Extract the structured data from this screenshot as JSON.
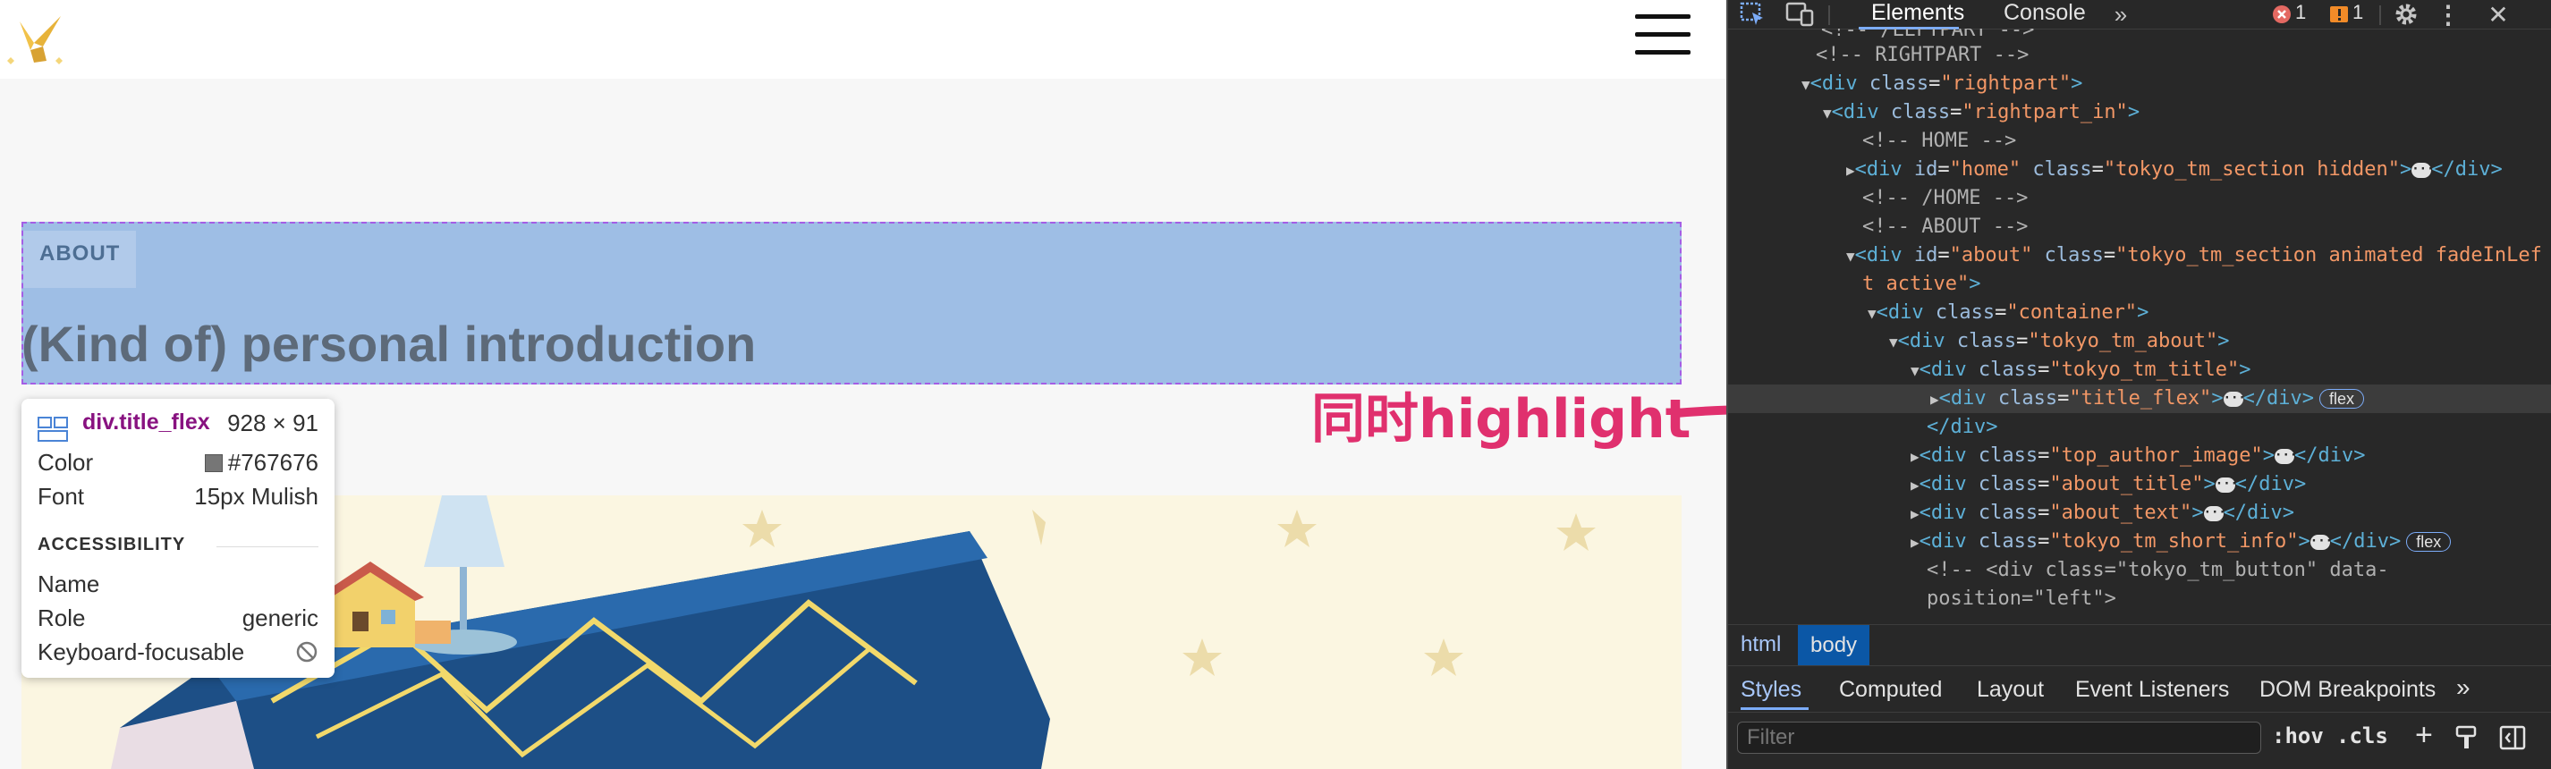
{
  "page": {
    "about_label": "ABOUT",
    "title": "(Kind of) personal introduction"
  },
  "annotation": {
    "text": "同时highlight",
    "color": "#e0306e"
  },
  "tooltip": {
    "element": "div.title_flex",
    "size": "928 × 91",
    "color_label": "Color",
    "color_value": "#767676",
    "font_label": "Font",
    "font_value": "15px Mulish",
    "accessibility_title": "ACCESSIBILITY",
    "name_label": "Name",
    "role_label": "Role",
    "role_value": "generic",
    "keyboard_label": "Keyboard-focusable"
  },
  "devtools": {
    "tabs": {
      "elements": "Elements",
      "console": "Console"
    },
    "error_count": "1",
    "warning_count": "1",
    "dom_lines": {
      "l0": "<!-- /LEFTPART -->",
      "l1": "<!-- RIGHTPART -->",
      "l2_tag": "div",
      "l2_attr": "class",
      "l2_val": "\"rightpart\"",
      "l3_tag": "div",
      "l3_attr": "class",
      "l3_val": "\"rightpart_in\"",
      "l4": "<!-- HOME -->",
      "l5_id_attr": "id",
      "l5_id_val": "\"home\"",
      "l5_attr": "class",
      "l5_val": "\"tokyo_tm_section hidden\"",
      "l6": "<!-- /HOME -->",
      "l7": "<!-- ABOUT -->",
      "l8_id_val": "\"about\"",
      "l8_val": "\"tokyo_tm_section animated fadeInLef",
      "l8b_val": "t active\"",
      "l10_val": "\"container\"",
      "l11_val": "\"tokyo_tm_about\"",
      "l12_val": "\"tokyo_tm_title\"",
      "l13_val": "\"title_flex\"",
      "l15_val": "\"top_author_image\"",
      "l16_val": "\"about_title\"",
      "l17_val": "\"about_text\"",
      "l18_val": "\"tokyo_tm_short_info\"",
      "l19": "<!-- <div class=\"tokyo_tm_button\" data-",
      "l20": "position=\"left\">"
    },
    "badge_flex": "flex",
    "breadcrumbs": {
      "html": "html",
      "body": "body"
    },
    "subtabs": {
      "styles": "Styles",
      "computed": "Computed",
      "layout": "Layout",
      "listeners": "Event Listeners",
      "breakpoints": "DOM Breakpoints"
    },
    "filter_placeholder": "Filter",
    "hov": ":hov",
    "cls": ".cls"
  }
}
